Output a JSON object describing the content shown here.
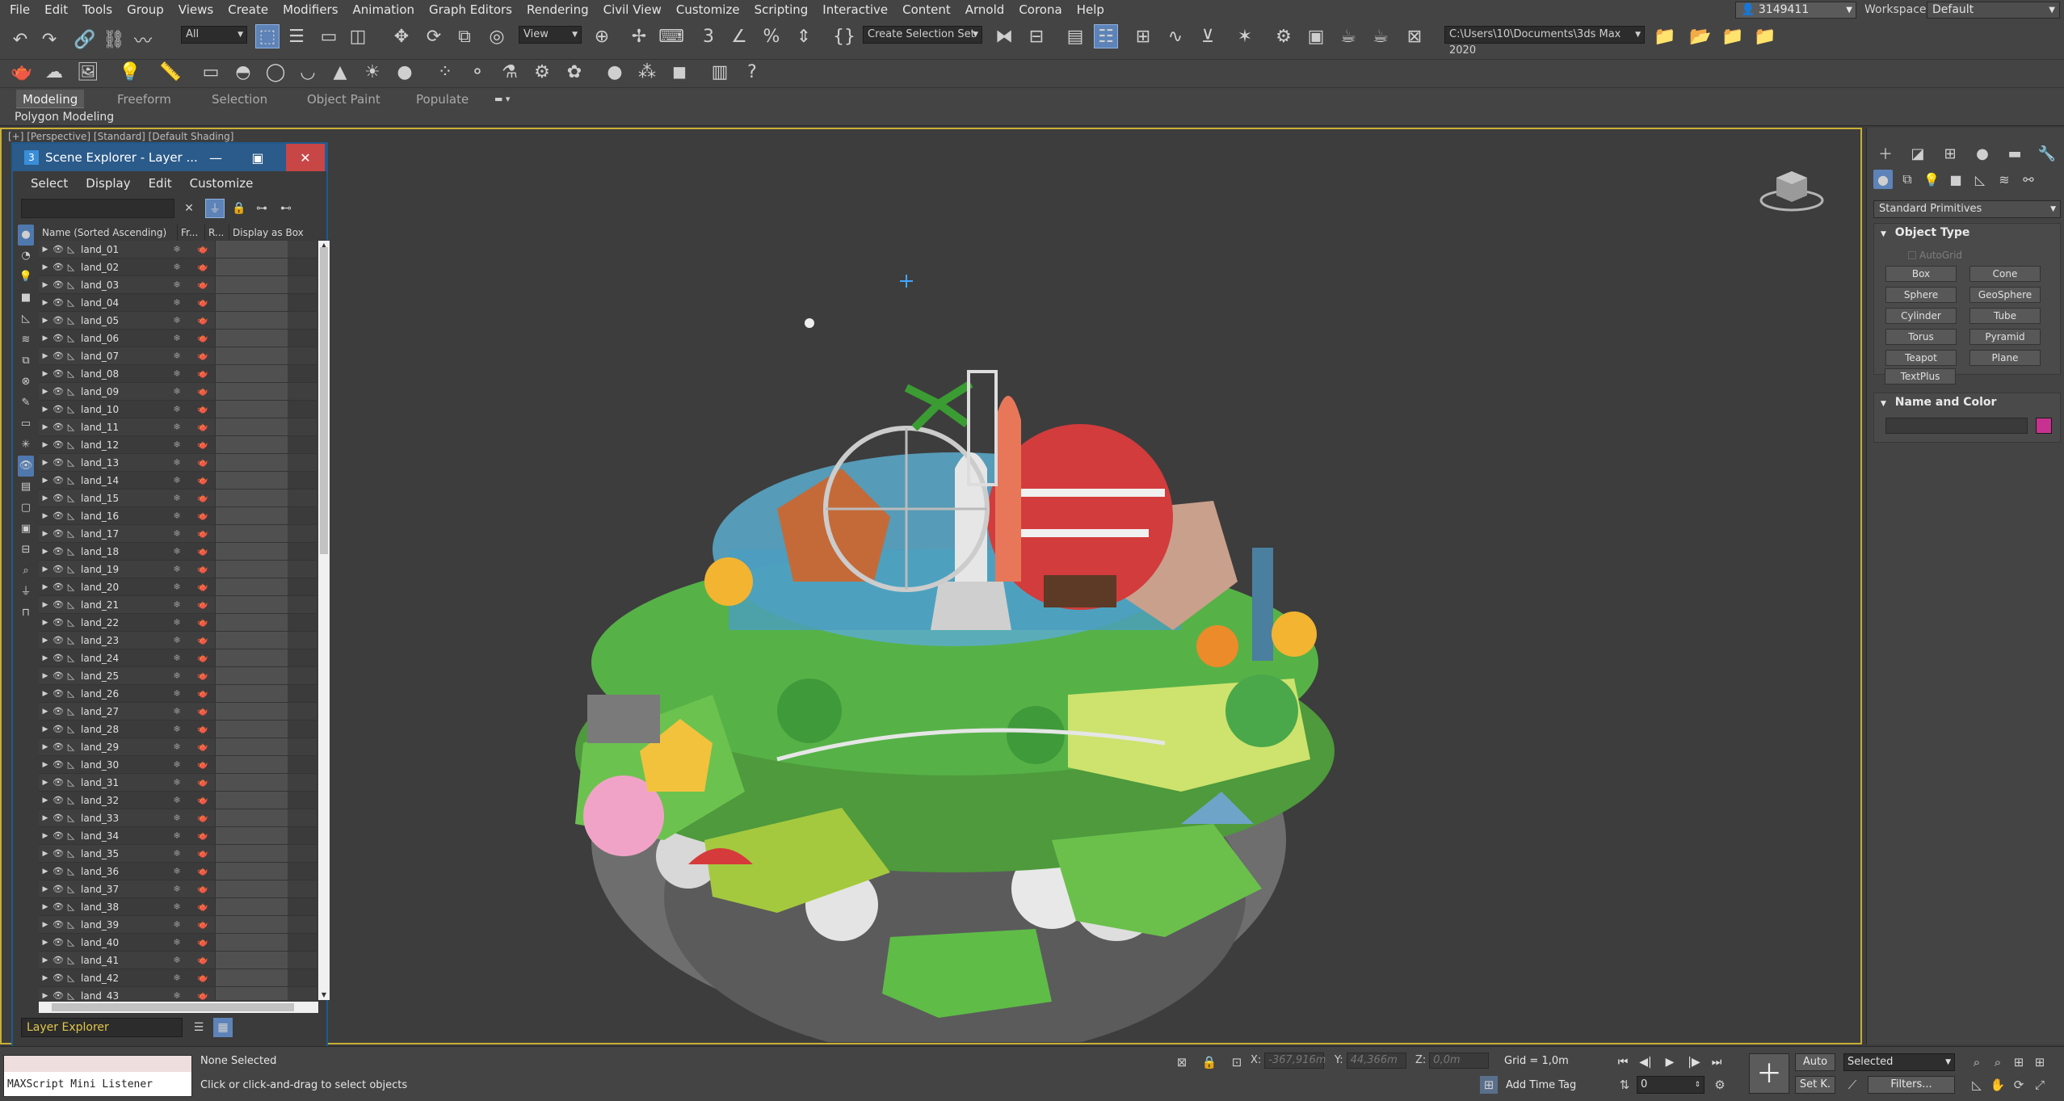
{
  "menubar": {
    "items": [
      "File",
      "Edit",
      "Tools",
      "Group",
      "Views",
      "Create",
      "Modifiers",
      "Animation",
      "Graph Editors",
      "Rendering",
      "Civil View",
      "Customize",
      "Scripting",
      "Interactive",
      "Content",
      "Arnold",
      "Corona",
      "Help"
    ],
    "user": "3149411",
    "workspaces_label": "Workspaces:",
    "workspace": "Default"
  },
  "toolbar": {
    "filter_value": "All",
    "view_value": "View",
    "selection_set": "Create Selection Set",
    "project_path": "C:\\Users\\10\\Documents\\3ds Max 2020"
  },
  "ribbon": {
    "tabs": [
      "Modeling",
      "Freeform",
      "Selection",
      "Object Paint",
      "Populate"
    ],
    "active": "Modeling",
    "sub_label": "Polygon Modeling"
  },
  "viewport": {
    "label": "[+] [Perspective] [Standard] [Default Shading]"
  },
  "scene_explorer": {
    "title": "Scene Explorer - Layer ...",
    "menu": [
      "Select",
      "Display",
      "Edit",
      "Customize"
    ],
    "columns": {
      "name": "Name (Sorted Ascending)",
      "frozen": "Fr...",
      "renderable": "R...",
      "display_box": "Display as Box"
    },
    "rows": [
      "land_01",
      "land_02",
      "land_03",
      "land_04",
      "land_05",
      "land_06",
      "land_07",
      "land_08",
      "land_09",
      "land_10",
      "land_11",
      "land_12",
      "land_13",
      "land_14",
      "land_15",
      "land_16",
      "land_17",
      "land_18",
      "land_19",
      "land_20",
      "land_21",
      "land_22",
      "land_23",
      "land_24",
      "land_25",
      "land_26",
      "land_27",
      "land_28",
      "land_29",
      "land_30",
      "land_31",
      "land_32",
      "land_33",
      "land_34",
      "land_35",
      "land_36",
      "land_37",
      "land_38",
      "land_39",
      "land_40",
      "land_41",
      "land_42",
      "land_43"
    ],
    "bottom_mode": "Layer Explorer"
  },
  "command_panel": {
    "category": "Standard Primitives",
    "object_type_title": "Object Type",
    "autogrid": "AutoGrid",
    "buttons": [
      "Box",
      "Cone",
      "Sphere",
      "GeoSphere",
      "Cylinder",
      "Tube",
      "Torus",
      "Pyramid",
      "Teapot",
      "Plane",
      "TextPlus"
    ],
    "name_color_title": "Name and Color",
    "color": "#c8318f"
  },
  "status": {
    "maxscript": "MAXScript Mini Listener",
    "selection": "None Selected",
    "prompt": "Click or click-and-drag to select objects",
    "x_label": "X:",
    "x_value": "-367,916m",
    "y_label": "Y:",
    "y_value": "44,366m",
    "z_label": "Z:",
    "z_value": "0,0m",
    "grid": "Grid = 1,0m",
    "add_time_tag": "Add Time Tag",
    "frame": "0",
    "auto": "Auto",
    "set_key": "Set K.",
    "selected": "Selected",
    "filters": "Filters..."
  }
}
